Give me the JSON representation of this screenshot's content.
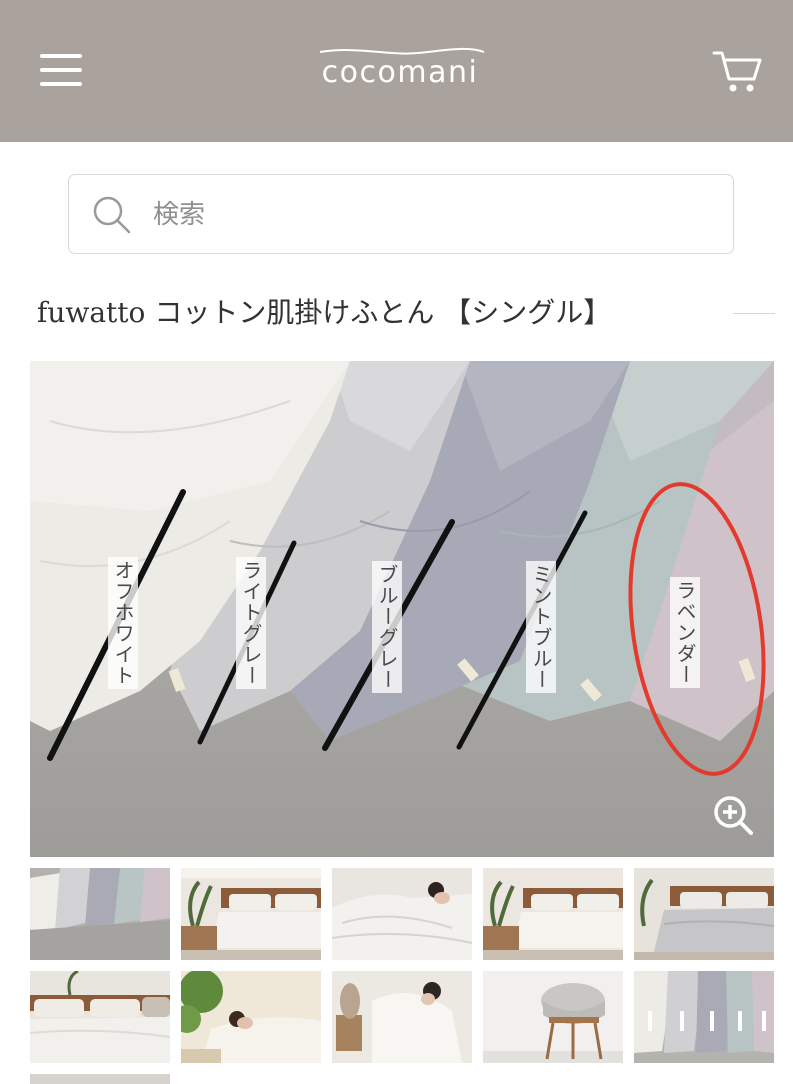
{
  "header": {
    "logo_text": "cocomani",
    "menu_icon": "hamburger-icon",
    "cart_icon": "cart-icon",
    "background_color": "#aaa29d"
  },
  "search": {
    "placeholder": "検索",
    "value": "",
    "icon": "search-icon"
  },
  "product": {
    "title": "fuwatto コットン肌掛けふとん 【シングル】"
  },
  "main_image": {
    "color_labels": [
      "オフホワイト",
      "ライトグレー",
      "ブルーグレー",
      "ミントブルー",
      "ラベンダー"
    ],
    "struck_colors": [
      "オフホワイト",
      "ライトグレー",
      "ブルーグレー",
      "ミントブルー"
    ],
    "circled_color": "ラベンダー",
    "zoom_icon": "zoom-in-icon"
  },
  "thumbnails": [
    {
      "scene": "folded-quilts-five-colors"
    },
    {
      "scene": "bedroom-bed-with-plant"
    },
    {
      "scene": "person-under-quilt"
    },
    {
      "scene": "bedroom-bed-with-plant"
    },
    {
      "scene": "bedroom-gray-quilt"
    },
    {
      "scene": "bed-pillows-closeup"
    },
    {
      "scene": "person-sleeping-white-bedding"
    },
    {
      "scene": "person-hugging-quilt"
    },
    {
      "scene": "rolled-quilt-on-stool"
    },
    {
      "scene": "quilts-color-lineup"
    }
  ]
}
